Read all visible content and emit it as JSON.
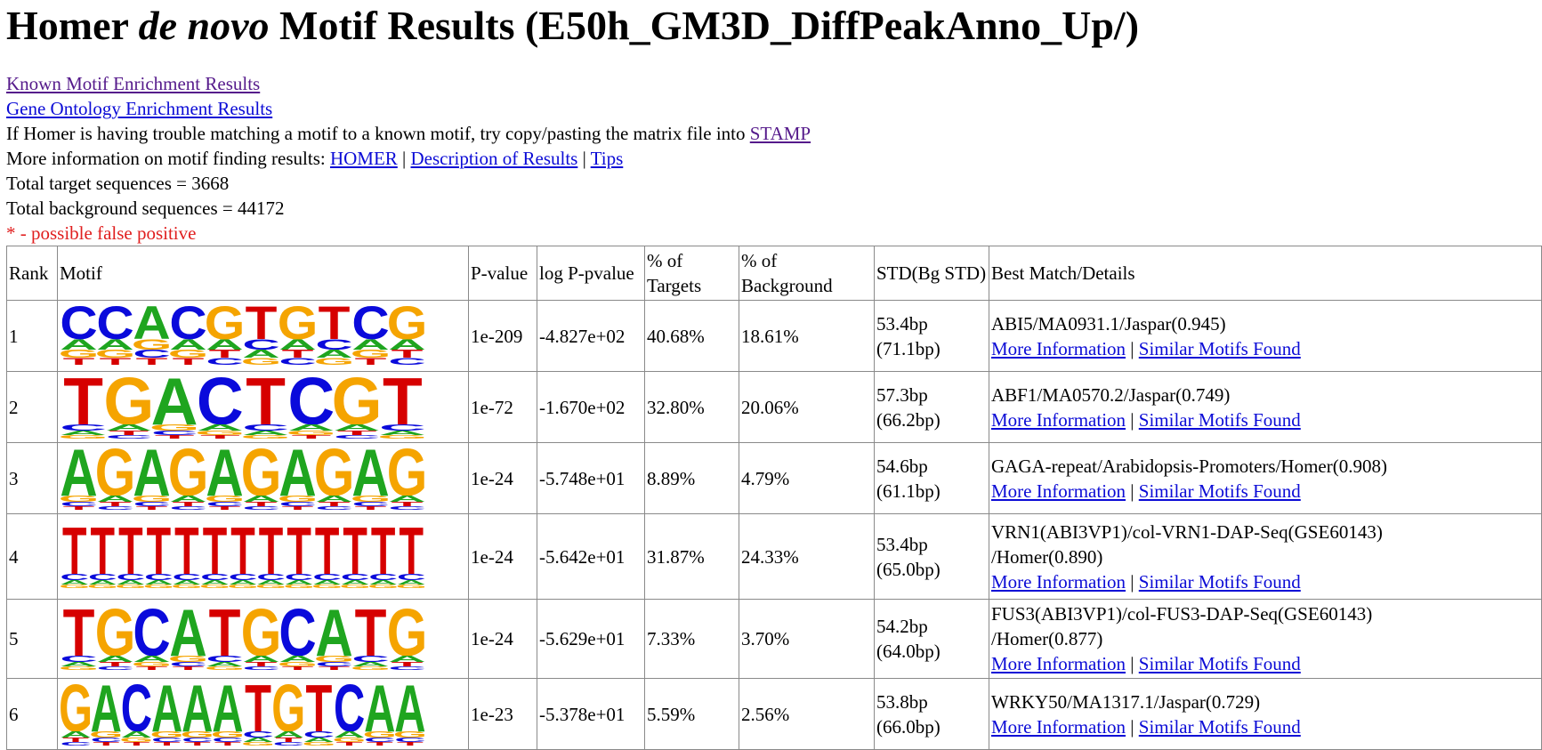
{
  "title_pre": "Homer",
  "title_italic": "de novo",
  "title_post": "Motif Results (E50h_GM3D_DiffPeakAnno_Up/)",
  "links": {
    "known": "Known Motif Enrichment Results",
    "go": "Gene Ontology Enrichment Results"
  },
  "stamp_text": "If Homer is having trouble matching a motif to a known motif, try copy/pasting the matrix file into",
  "stamp_link": "STAMP",
  "moreinfo_text": "More information on motif finding results:",
  "moreinfo_links": [
    "HOMER",
    "Description of Results",
    "Tips"
  ],
  "sep": "|",
  "total_target": "Total target sequences = 3668",
  "total_background": "Total background sequences = 44172",
  "false_positive_note": "* - possible false positive",
  "table": {
    "headers": {
      "rank": "Rank",
      "motif": "Motif",
      "pvalue": "P-value",
      "logp": "log P-pvalue",
      "targets": "% of Targets",
      "background": "% of Background",
      "std": "STD(Bg STD)",
      "best": "Best Match/Details"
    },
    "more_info_label": "More Information",
    "similar_label": "Similar Motifs Found",
    "rows": [
      {
        "rank": "1",
        "motif": "CCACGTGTCG",
        "pvalue": "1e-209",
        "logp": "-4.827e+02",
        "targets": "40.68%",
        "background": "18.61%",
        "std": "53.4bp",
        "bgstd": "(71.1bp)",
        "match1": "ABI5/MA0931.1/Jaspar(0.945)",
        "match2": ""
      },
      {
        "rank": "2",
        "motif": "TGACTCGT",
        "pvalue": "1e-72",
        "logp": "-1.670e+02",
        "targets": "32.80%",
        "background": "20.06%",
        "std": "57.3bp",
        "bgstd": "(66.2bp)",
        "match1": "ABF1/MA0570.2/Jaspar(0.749)",
        "match2": ""
      },
      {
        "rank": "3",
        "motif": "AGAGAGAGAG",
        "pvalue": "1e-24",
        "logp": "-5.748e+01",
        "targets": "8.89%",
        "background": "4.79%",
        "std": "54.6bp",
        "bgstd": "(61.1bp)",
        "match1": "GAGA-repeat/Arabidopsis-Promoters/Homer(0.908)",
        "match2": ""
      },
      {
        "rank": "4",
        "motif": "TTTTTTTTTTTTT",
        "pvalue": "1e-24",
        "logp": "-5.642e+01",
        "targets": "31.87%",
        "background": "24.33%",
        "std": "53.4bp",
        "bgstd": "(65.0bp)",
        "match1": "VRN1(ABI3VP1)/col-VRN1-DAP-Seq(GSE60143)",
        "match2": "/Homer(0.890)"
      },
      {
        "rank": "5",
        "motif": "TGCATGCATG",
        "pvalue": "1e-24",
        "logp": "-5.629e+01",
        "targets": "7.33%",
        "background": "3.70%",
        "std": "54.2bp",
        "bgstd": "(64.0bp)",
        "match1": "FUS3(ABI3VP1)/col-FUS3-DAP-Seq(GSE60143)",
        "match2": "/Homer(0.877)"
      },
      {
        "rank": "6",
        "motif": "GACAAATGTCAA",
        "pvalue": "1e-23",
        "logp": "-5.378e+01",
        "targets": "5.59%",
        "background": "2.56%",
        "std": "53.8bp",
        "bgstd": "(66.0bp)",
        "match1": "WRKY50/MA1317.1/Jaspar(0.729)",
        "match2": ""
      }
    ]
  },
  "colors": {
    "A": "#1fa51f",
    "C": "#0a0adb",
    "G": "#f5a400",
    "T": "#d60000",
    "link": "#0b0bd6",
    "visited": "#551a8b",
    "warning": "#e01e1e"
  }
}
